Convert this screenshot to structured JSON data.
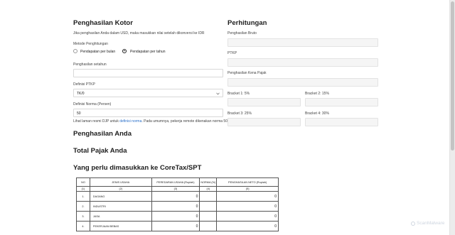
{
  "left": {
    "title": "Penghasilan Kotor",
    "note": "Jika penghasilan Anda dalam USD, maka masukkan nilai setelah dikonversi ke IDR",
    "method_label": "Metode Penghitungan",
    "method_options": [
      "Pendapatan per bulan",
      "Pendapatan per tahun"
    ],
    "income_label": "Penghasilan setahun",
    "income_value": "",
    "ptkp_label": "Definisi PTKP",
    "ptkp_value": "TK/0",
    "norma_label": "Definisi Norma (Persen)",
    "norma_value": "50",
    "footnote_pre": "Lihat laman resmi DJP untuk",
    "footnote_link": "definisi norma",
    "footnote_post": ". Pada umumnya, pekerja remote dikenakan norma 50%."
  },
  "right": {
    "title": "Perhitungan",
    "fields": [
      {
        "label": "Penghasilan Bruto",
        "value": ""
      },
      {
        "label": "PTKP",
        "value": ""
      },
      {
        "label": "Penghasilan Kena Pajak",
        "value": ""
      }
    ],
    "brackets": [
      {
        "label": "Bracket 1: 5%",
        "value": ""
      },
      {
        "label": "Bracket 2: 15%",
        "value": ""
      },
      {
        "label": "Bracket 3: 25%",
        "value": ""
      },
      {
        "label": "Bracket 4: 30%",
        "value": ""
      }
    ]
  },
  "sections": {
    "penghasilan": "Penghasilan Anda",
    "total": "Total Pajak Anda",
    "coretax": "Yang perlu dimasukkan ke CoreTax/SPT"
  },
  "table": {
    "headers": [
      "NO",
      "JENIS USAHA",
      "PEREDARAN USAHA (Rupiah)",
      "NORMA (%)",
      "PENGHASILAN NETO (Rupiah)"
    ],
    "index": [
      "(1)",
      "(2)",
      "(3)",
      "(4)",
      "(5)"
    ],
    "rows": [
      {
        "no": "1.",
        "name": "DAGANG",
        "peredaran": "0",
        "norma": "",
        "neto": "0"
      },
      {
        "no": "2.",
        "name": "INDUSTRI",
        "peredaran": "0",
        "norma": "",
        "neto": "0"
      },
      {
        "no": "3.",
        "name": "JASA",
        "peredaran": "0",
        "norma": "",
        "neto": "0"
      },
      {
        "no": "4.",
        "name": "PEKERJAAN BEBAS",
        "peredaran": "0",
        "norma": "",
        "neto": "0"
      }
    ]
  },
  "watermark": "ScanMalware",
  "icons": {
    "select": "chevron-down-icon",
    "watermark": "shield-icon"
  }
}
